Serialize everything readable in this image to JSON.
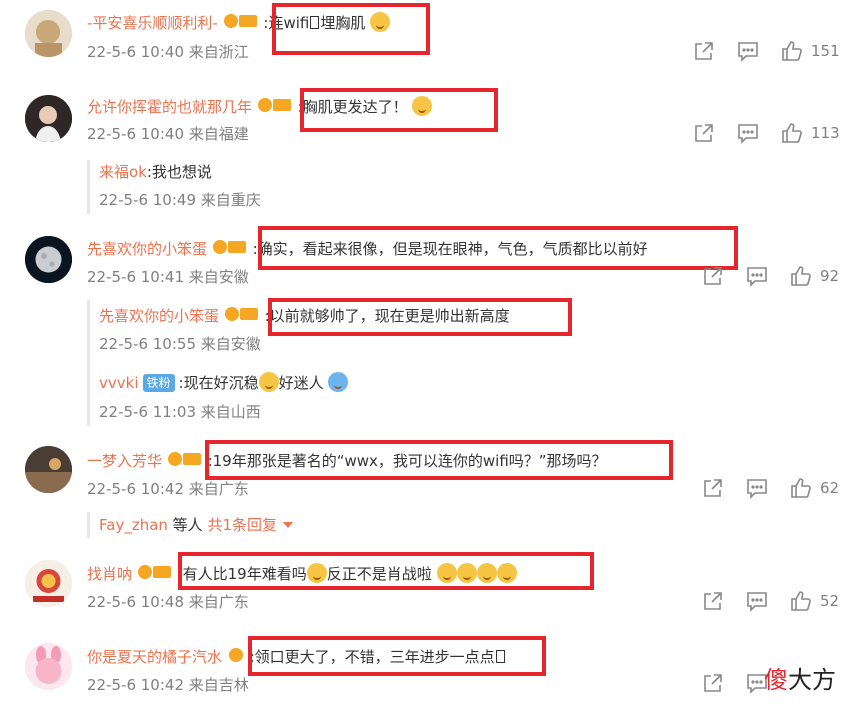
{
  "comments": [
    {
      "user": "-平安喜乐顺顺利利-",
      "text_pre": ":连wifi",
      "text_post": "埋胸肌",
      "meta": "22-5-6 10:40 来自浙江",
      "forward": "",
      "like": "151"
    },
    {
      "user": "允许你挥霍的也就那几年",
      "text": ":胸肌更发达了！",
      "meta": "22-5-6 10:40 来自福建",
      "like": "113",
      "replies": [
        {
          "user": "来福ok",
          "text": ":我也想说",
          "meta": "22-5-6 10:49 来自重庆"
        }
      ]
    },
    {
      "user": "先喜欢你的小笨蛋",
      "text": ":确实，看起来很像，但是现在眼神，气色，气质都比以前好",
      "meta": "22-5-6 10:41 来自安徽",
      "like": "92",
      "replies": [
        {
          "user": "先喜欢你的小笨蛋",
          "text": ":以前就够帅了，现在更是帅出新高度",
          "meta": "22-5-6 10:55 来自安徽"
        },
        {
          "user": "vvvki",
          "badge": "铁粉",
          "text_pre": ":现在好沉稳",
          "text_post": "好迷人",
          "meta": "22-5-6 11:03 来自山西"
        }
      ]
    },
    {
      "user": "一梦入芳华",
      "text": ":19年那张是著名的“wwx，我可以连你的wifi吗？”那场吗？",
      "meta": "22-5-6 10:42 来自广东",
      "like": "62",
      "more_user": "Fay_zhan",
      "more_mid": " 等人 ",
      "more_link": "共1条回复"
    },
    {
      "user": "找肖呐",
      "text_pre": ":有人比19年难看吗",
      "text_post": "反正不是肖战啦",
      "meta": "22-5-6 10:48 来自广东",
      "like": "52"
    },
    {
      "user": "你是夏天的橘子汽水",
      "text": ":领口更大了，不错，三年进步一点点",
      "meta": "22-5-6 10:42 来自吉林"
    }
  ],
  "watermark": {
    "red": "傻",
    "black": "大方"
  },
  "colors": {
    "username": "#eb7350",
    "highlight_box": "#e5262d",
    "meta": "#808080"
  },
  "icons": {
    "forward": "share-icon",
    "comment": "comment-icon",
    "like": "thumbs-up-icon"
  }
}
